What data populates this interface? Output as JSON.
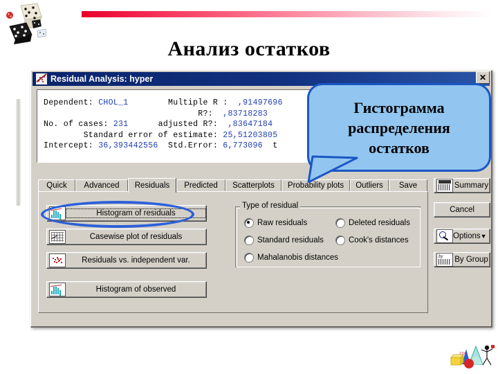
{
  "slide": {
    "title": "Анализ остатков",
    "decor": {
      "dice_icon": "dice-image",
      "rule_color": "#e8002a",
      "clipart_icon": "statistics-clipart"
    }
  },
  "callout": {
    "line1": "Гистограмма",
    "line2": "распределения",
    "line3": "остатков",
    "fill_color": "#92c6f0",
    "border_color": "#1a56c4"
  },
  "highlight": {
    "target": "Histogram of residuals",
    "color": "#2b60d8"
  },
  "dialog": {
    "title": "Residual Analysis: hyper",
    "close_label": "✕",
    "titlebar_color": "#0a246a",
    "results": {
      "line1_label_a": "Dependent:",
      "line1_value_a": "CHOL_1",
      "line1_label_b": "Multiple R :",
      "line1_value_b": ",91497696",
      "line2_label": "R?:",
      "line2_value": ",83718283",
      "line3_label_a": "No. of cases:",
      "line3_value_a": "231",
      "line3_label_b": "adjusted R?:",
      "line3_value_b": ",83647184",
      "line4_label": "Standard error of estimate:",
      "line4_value": "25,51203805",
      "line5_label_a": "Intercept:",
      "line5_value_a": "36,393442556",
      "line5_label_b": "Std.Error:",
      "line5_value_b": "6,773096",
      "line5_trail": "t"
    },
    "tabs": [
      {
        "label": "Quick",
        "active": false
      },
      {
        "label": "Advanced",
        "active": false
      },
      {
        "label": "Residuals",
        "active": true
      },
      {
        "label": "Predicted",
        "active": false
      },
      {
        "label": "Scatterplots",
        "active": false
      },
      {
        "label": "Probability plots",
        "active": false
      },
      {
        "label": "Outliers",
        "active": false
      },
      {
        "label": "Save",
        "active": false
      }
    ],
    "action_buttons": [
      {
        "label": "Histogram of residuals",
        "icon": "histogram-icon"
      },
      {
        "label": "Casewise plot of residuals",
        "icon": "grid-plot-icon"
      },
      {
        "label": "Residuals vs. independent var.",
        "icon": "scatter-plot-icon"
      },
      {
        "label": "Histogram of observed",
        "icon": "histogram-icon"
      }
    ],
    "group_type_of_residual": {
      "legend": "Type of residual",
      "options": [
        {
          "label": "Raw residuals",
          "checked": true
        },
        {
          "label": "Deleted residuals",
          "checked": false
        },
        {
          "label": "Standard residuals",
          "checked": false
        },
        {
          "label": "Cook's distances",
          "checked": false
        },
        {
          "label": "Mahalanobis distances",
          "checked": false
        }
      ]
    },
    "side_buttons": [
      {
        "label": "Summary",
        "icon": "summary-table-icon"
      },
      {
        "label": "Cancel",
        "icon": ""
      },
      {
        "label": "Options",
        "icon": "options-icon",
        "caret": "▼"
      },
      {
        "label": "By Group",
        "icon": "by-group-icon"
      }
    ]
  }
}
